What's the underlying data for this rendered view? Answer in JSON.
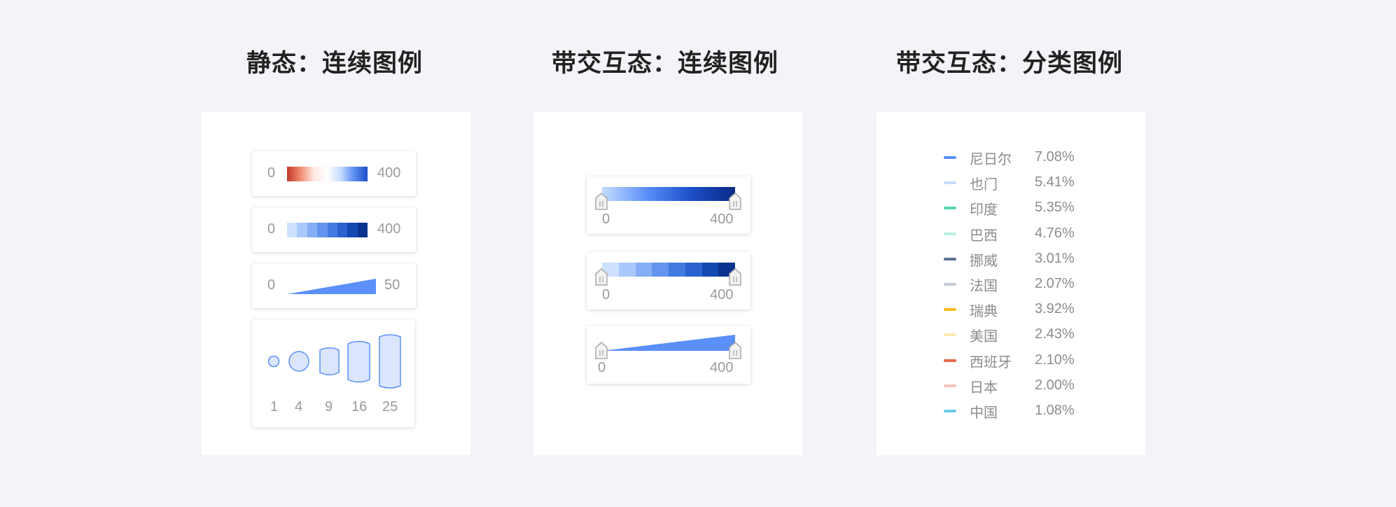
{
  "titles": {
    "static_continuous": "静态：连续图例",
    "interactive_continuous": "带交互态：连续图例",
    "interactive_categorical": "带交互态：分类图例"
  },
  "static_legends": {
    "gradient": {
      "min": "0",
      "max": "400"
    },
    "stepped": {
      "min": "0",
      "max": "400"
    },
    "size": {
      "min": "0",
      "max": "50"
    },
    "bubbles": [
      "1",
      "4",
      "9",
      "16",
      "25"
    ]
  },
  "interactive_legends": {
    "gradient": {
      "min": "0",
      "max": "400"
    },
    "stepped": {
      "min": "0",
      "max": "400"
    },
    "size": {
      "min": "0",
      "max": "400"
    }
  },
  "colors": {
    "step_blues": [
      "#cde1ff",
      "#a9c8fb",
      "#86aef6",
      "#6395ee",
      "#427be0",
      "#2a63cf",
      "#1449b2",
      "#0a338f"
    ],
    "primary_blue": "#5b8ff9"
  },
  "categories": [
    {
      "name": "尼日尔",
      "value": "7.08%",
      "color": "#5b8ff9"
    },
    {
      "name": "也门",
      "value": "5.41%",
      "color": "#c8daf9"
    },
    {
      "name": "印度",
      "value": "5.35%",
      "color": "#5ad8a6"
    },
    {
      "name": "巴西",
      "value": "4.76%",
      "color": "#bcefe0"
    },
    {
      "name": "挪威",
      "value": "3.01%",
      "color": "#5d7092"
    },
    {
      "name": "法国",
      "value": "2.07%",
      "color": "#c5cad6"
    },
    {
      "name": "瑞典",
      "value": "3.92%",
      "color": "#f6bd16"
    },
    {
      "name": "美国",
      "value": "2.43%",
      "color": "#fbe8b0"
    },
    {
      "name": "西班牙",
      "value": "2.10%",
      "color": "#e8684a"
    },
    {
      "name": "日本",
      "value": "2.00%",
      "color": "#f6c3b7"
    },
    {
      "name": "中国",
      "value": "1.08%",
      "color": "#6dc8ec"
    }
  ]
}
